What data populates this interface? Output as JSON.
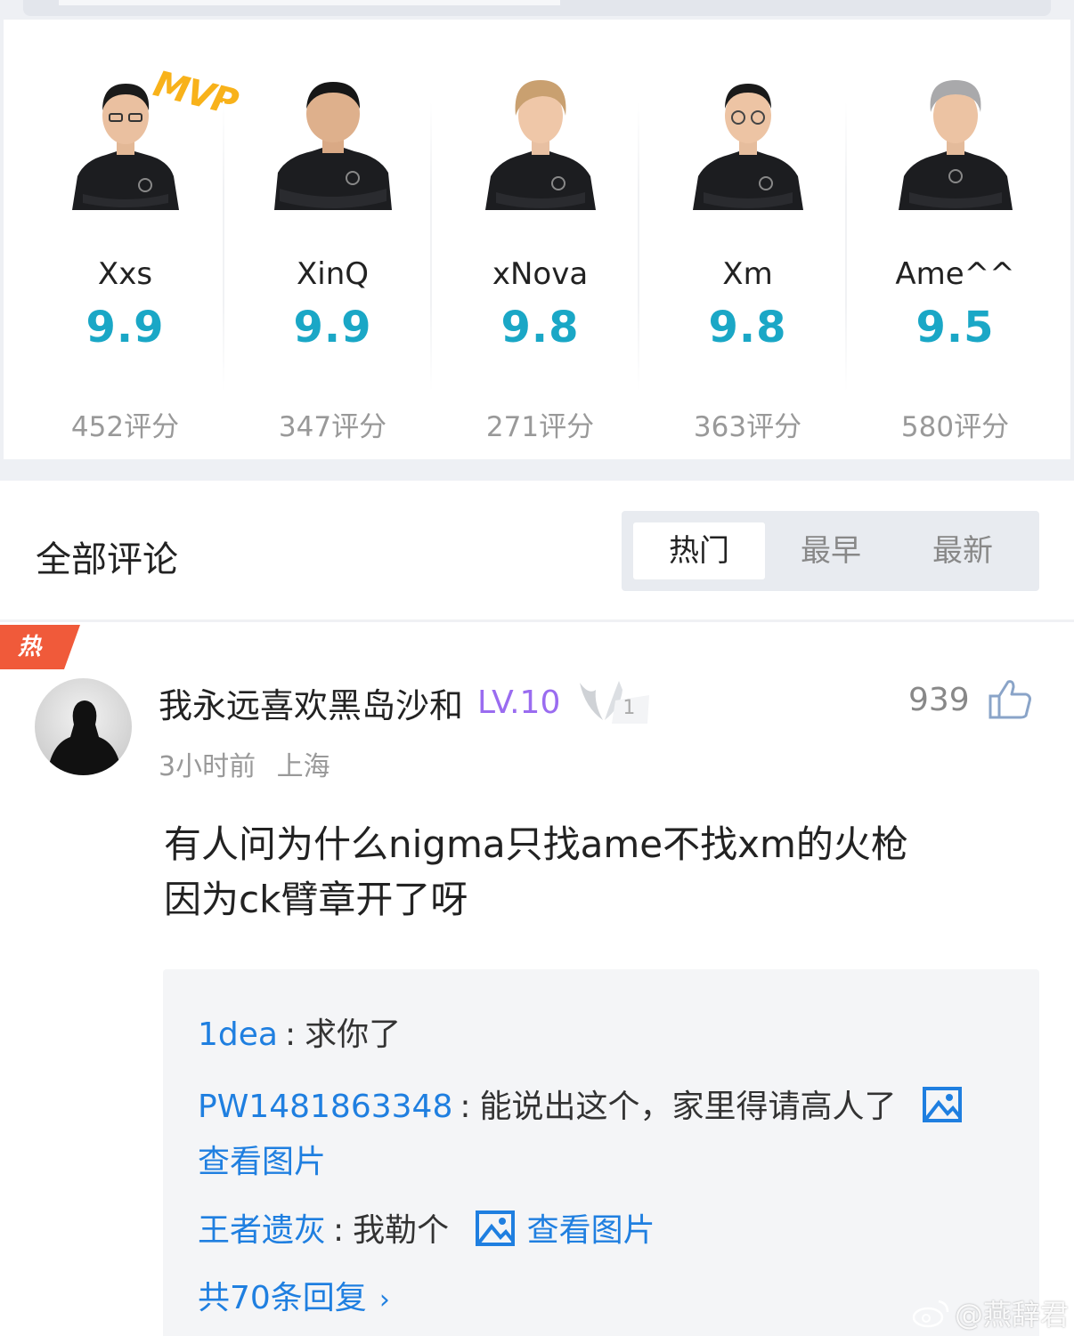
{
  "players": [
    {
      "name": "Xxs",
      "score": "9.9",
      "count": "452评分",
      "jersey": "#1c1d20"
    },
    {
      "name": "XinQ",
      "score": "9.9",
      "count": "347评分",
      "jersey": "#1c1d20"
    },
    {
      "name": "xNova",
      "score": "9.8",
      "count": "271评分",
      "jersey": "#1c1d20"
    },
    {
      "name": "Xm",
      "score": "9.8",
      "count": "363评分",
      "jersey": "#1c1d20"
    },
    {
      "name": "Ame^^",
      "score": "9.5",
      "count": "580评分",
      "jersey": "#1c1d20"
    }
  ],
  "mvp_label": "MVP",
  "comments_title": "全部评论",
  "sort_tabs": [
    {
      "label": "热门",
      "active": true
    },
    {
      "label": "最早",
      "active": false
    },
    {
      "label": "最新",
      "active": false
    }
  ],
  "comment": {
    "hot_tag": "热",
    "username": "我永远喜欢黑岛沙和",
    "level": "LV.10",
    "badge_number": "1",
    "time": "3小时前",
    "location": "上海",
    "likes": "939",
    "body_line1": "有人问为什么nigma只找ame不找xm的火枪",
    "body_line2": "因为ck臂章开了呀"
  },
  "replies": [
    {
      "author": "1dea",
      "text": "求你了"
    },
    {
      "author": "PW1481863348",
      "text": "能说出这个，家里得请高人了",
      "view_image": "查看图片"
    },
    {
      "author": "王者遗灰",
      "text": "我勒个",
      "view_image": "查看图片"
    }
  ],
  "more_replies": "共70条回复",
  "separator": ":",
  "watermark": "@燕辞君",
  "colors": {
    "score": "#1aa7c6",
    "link": "#1f7fe0",
    "level": "#9a6cf0",
    "hot": "#f05a3a",
    "mvp": "#f8b21a"
  }
}
